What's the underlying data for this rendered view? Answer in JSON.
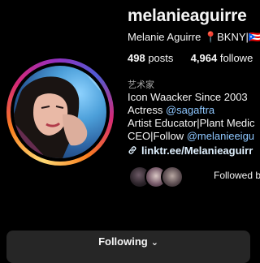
{
  "profile": {
    "username": "melanieaguirre",
    "full_name": "Melanie Aguirre 📍BKNY|🇵🇷",
    "posts_count": "498",
    "posts_label": "posts",
    "followers_count": "4,964",
    "followers_label": "followe",
    "category": "艺术家",
    "bio": {
      "line1": "Icon Waacker Since 2003",
      "line2_prefix": "Actress ",
      "line2_mention": "@sagaftra",
      "line3": "Artist Educator|Plant Medic",
      "line4_prefix": "CEO|Follow ",
      "line4_mention": "@melanieeigu"
    },
    "link": "linktr.ee/Melanieaguirr",
    "followed_by": "Followed by"
  },
  "actions": {
    "following_label": "Following",
    "following_chevron": "⌄"
  },
  "icons": {
    "link": "link-icon"
  },
  "colors": {
    "background": "#000000",
    "button": "#262626",
    "link": "#e0f1ff",
    "muted": "#a8a8a8"
  }
}
